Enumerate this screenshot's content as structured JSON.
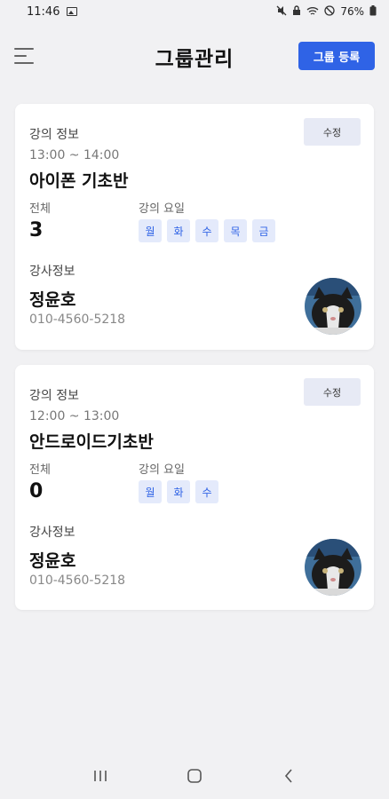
{
  "status_bar": {
    "time": "11:46",
    "battery": "76%",
    "icons": [
      "image-icon",
      "mute-icon",
      "lock-icon",
      "wifi-icon",
      "blocked-icon",
      "battery-icon"
    ]
  },
  "header": {
    "title": "그룹관리",
    "register_label": "그룹 등록",
    "menu_icon": "menu-icon"
  },
  "colors": {
    "accent": "#2f63e6",
    "chip_bg": "#e4eafb",
    "edit_bg": "#e7eaf5",
    "page_bg": "#f1f1f3"
  },
  "groups": [
    {
      "section_label": "강의 정보",
      "edit_label": "수정",
      "time": "13:00 ~ 14:00",
      "name": "아이폰 기초반",
      "count_label": "전체",
      "count": "3",
      "days_label": "강의 요일",
      "days": [
        "월",
        "화",
        "수",
        "목",
        "금"
      ],
      "instructor_label": "강사정보",
      "instructor_name": "정윤호",
      "instructor_phone": "010-4560-5218"
    },
    {
      "section_label": "강의 정보",
      "edit_label": "수정",
      "time": "12:00 ~ 13:00",
      "name": "안드로이드기초반",
      "count_label": "전체",
      "count": "0",
      "days_label": "강의 요일",
      "days": [
        "월",
        "화",
        "수"
      ],
      "instructor_label": "강사정보",
      "instructor_name": "정윤호",
      "instructor_phone": "010-4560-5218"
    }
  ],
  "nav_bar": {
    "buttons": [
      "recents-icon",
      "home-icon",
      "back-icon"
    ]
  }
}
